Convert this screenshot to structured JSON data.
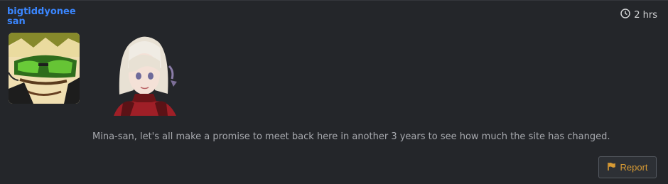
{
  "post": {
    "author": "bigtiddyoneesan",
    "time": "2 hrs",
    "message": "Mina-san, let's all make a promise to meet back here in another 3 years to see how much the site has changed.",
    "report_label": "Report"
  },
  "icons": {
    "time": "clock-icon",
    "report": "flag-icon"
  },
  "colors": {
    "username": "#3a86ff",
    "report_text": "#d79a34",
    "background": "#24262a"
  }
}
